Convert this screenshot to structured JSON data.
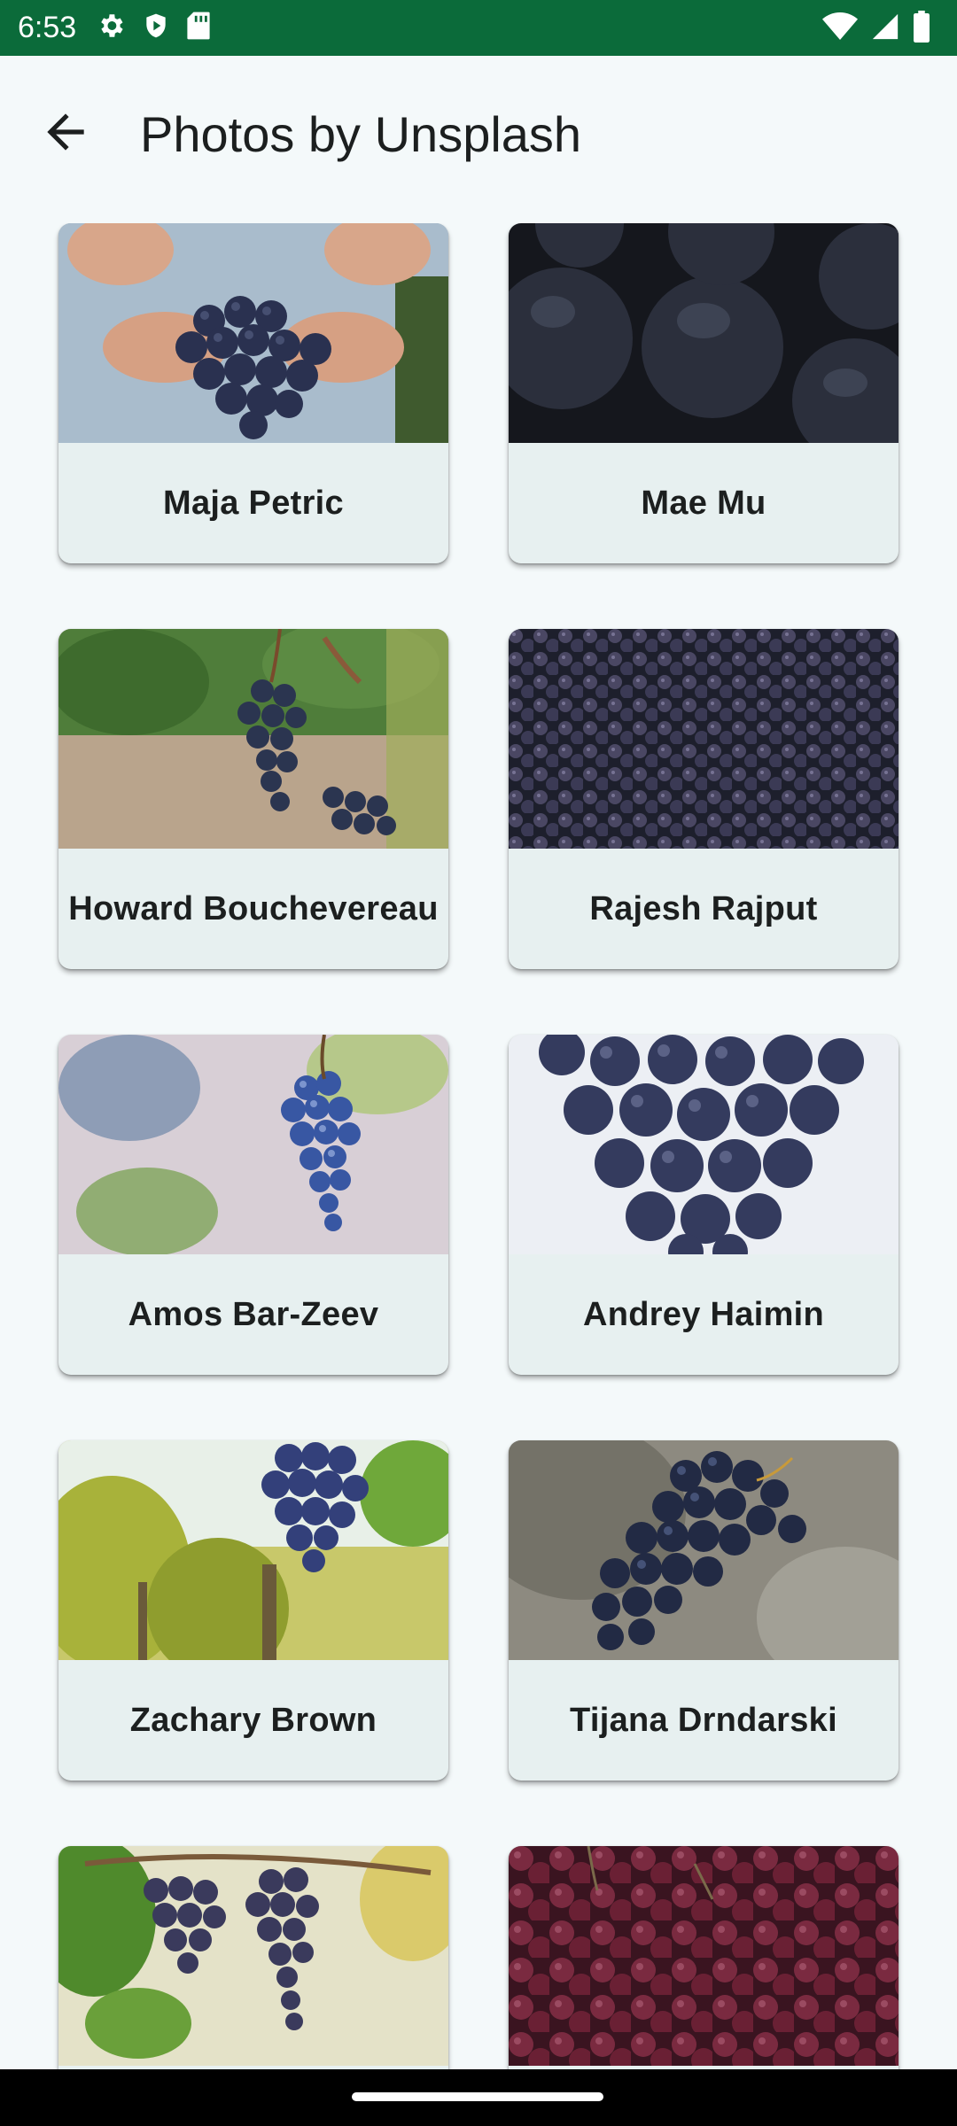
{
  "status_bar": {
    "time": "6:53",
    "background": "#0b6b3a",
    "left_icons": [
      "gear-icon",
      "play-protect-icon",
      "sd-card-icon"
    ],
    "right_icons": [
      "wifi-icon",
      "cell-signal-icon",
      "battery-icon"
    ]
  },
  "app_bar": {
    "title": "Photos by Unsplash",
    "back_icon": "arrow-back-icon"
  },
  "photos": [
    {
      "photographer": "Maja Petric",
      "subject": "hands holding grapes"
    },
    {
      "photographer": "Mae Mu",
      "subject": "dark grapes close-up"
    },
    {
      "photographer": "Howard Bouchevereau",
      "subject": "grapes on vine"
    },
    {
      "photographer": "Rajesh Rajput",
      "subject": "pile of grapes"
    },
    {
      "photographer": "Amos Bar-Zeev",
      "subject": "blue grape bunch"
    },
    {
      "photographer": "Andrey Haimin",
      "subject": "grape bunch white background"
    },
    {
      "photographer": "Zachary Brown",
      "subject": "vineyard grapes"
    },
    {
      "photographer": "Tijana Drndarski",
      "subject": "grapes on stone"
    },
    {
      "photographer": "",
      "subject": "grapes with leaves"
    },
    {
      "photographer": "",
      "subject": "red grapes"
    }
  ]
}
